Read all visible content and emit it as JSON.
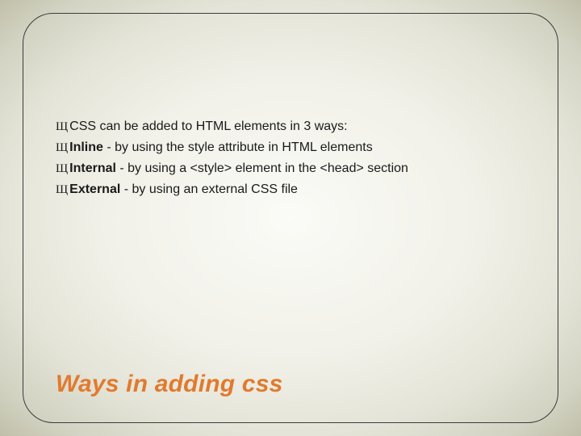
{
  "bullet_glyph": "Щ",
  "bullets": [
    {
      "bold": "",
      "text": "CSS can be added to HTML elements in 3 ways:"
    },
    {
      "bold": "Inline",
      "text": " - by using the style attribute in HTML elements"
    },
    {
      "bold": "Internal",
      "text": " - by using a <style> element in the <head> section"
    },
    {
      "bold": "External",
      "text": " - by using an external CSS file"
    }
  ],
  "title": "Ways in adding css"
}
